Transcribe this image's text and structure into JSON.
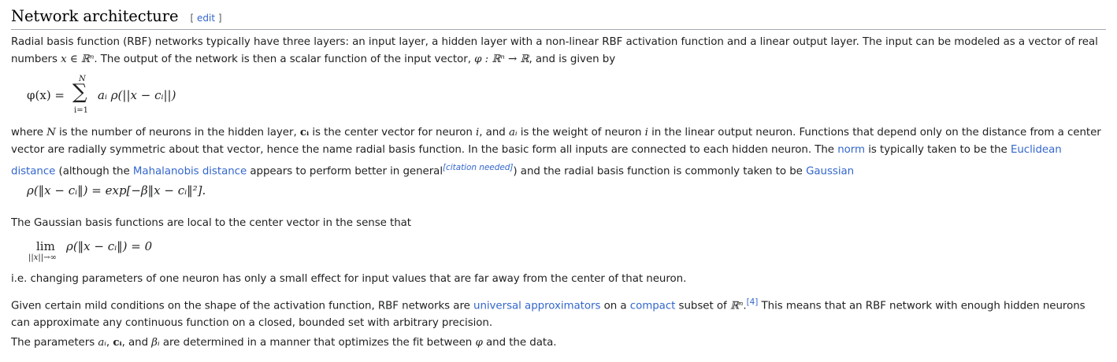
{
  "heading": {
    "title": "Network architecture",
    "edit_label": "edit",
    "bracket_open": "[",
    "bracket_close": "]"
  },
  "para1": {
    "text_a": "Radial basis function (RBF) networks typically have three layers: an input layer, a hidden layer with a non-linear RBF activation function and a linear output layer. The input can be modeled as a vector of real numbers ",
    "math_a": "x ∈ ℝⁿ",
    "text_b": ". The output of the network is then a scalar function of the input vector, ",
    "math_b": "φ : ℝⁿ → ℝ",
    "text_c": ", and is given by"
  },
  "formula1": {
    "lhs": "φ(x) =",
    "sum_top": "N",
    "sum_sym": "∑",
    "sum_bottom": "i=1",
    "rhs": "aᵢ ρ(||x − cᵢ||)"
  },
  "para2": {
    "t1": "where ",
    "m1": "N",
    "t2": " is the number of neurons in the hidden layer, ",
    "m2": "cᵢ",
    "t3": " is the center vector for neuron ",
    "m3": "i",
    "t4": ", and ",
    "m4": "aᵢ",
    "t5": " is the weight of neuron ",
    "m5": "i",
    "t6": " in the linear output neuron. Functions that depend only on the distance from a center vector are radially symmetric about that vector, hence the name radial basis function. In the basic form all inputs are connected to each hidden neuron. The ",
    "link_norm": "norm",
    "t7": " is typically taken to be the ",
    "link_euclid": "Euclidean distance",
    "t8": " (although the ",
    "link_mahal": "Mahalanobis distance",
    "t9": " appears to perform better in general",
    "citation": "[citation needed]",
    "t10": ") and the radial basis function is commonly taken to be ",
    "link_gauss": "Gaussian"
  },
  "formula2": {
    "text": "ρ(‖x − cᵢ‖) = exp[−β‖x − cᵢ‖²]."
  },
  "para3": {
    "text": "The Gaussian basis functions are local to the center vector in the sense that"
  },
  "formula3": {
    "lim": "lim",
    "sub": "||x||→∞",
    "rest": "ρ(‖x − cᵢ‖) = 0"
  },
  "para4": {
    "text": "i.e. changing parameters of one neuron has only a small effect for input values that are far away from the center of that neuron."
  },
  "para5": {
    "t1": "Given certain mild conditions on the shape of the activation function, RBF networks are ",
    "link_universal": "universal approximators",
    "t2": " on a ",
    "link_compact": "compact",
    "t3": " subset of ",
    "m1": "ℝⁿ",
    "t4": ".",
    "ref": "[4]",
    "t5": " This means that an RBF network with enough hidden neurons can approximate any continuous function on a closed, bounded set with arbitrary precision."
  },
  "para6": {
    "t1": "The parameters ",
    "m1": "aᵢ",
    "t2": ", ",
    "m2": "cᵢ",
    "t3": ", and ",
    "m3": "βᵢ",
    "t4": " are determined in a manner that optimizes the fit between ",
    "m4": "φ",
    "t5": " and the data."
  }
}
